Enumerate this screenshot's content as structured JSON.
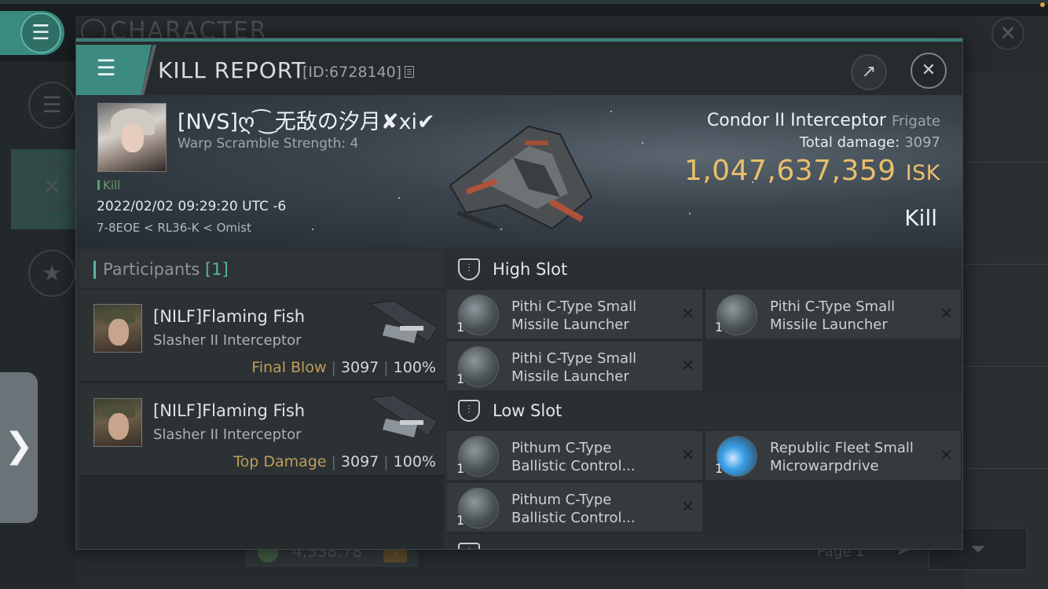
{
  "background": {
    "title": "CHARACTER",
    "footer_value": "4,338.78",
    "page_label": "Page 1"
  },
  "dialog": {
    "title": "KILL REPORT",
    "id_label": "[ID:6728140]"
  },
  "victim": {
    "name": "[NVS]ღ ͡ ͜ 无敌の汐月✘xi✔",
    "subtitle": "Warp Scramble Strength: 4",
    "badge": "Kill",
    "timestamp": "2022/02/02 09:29:20 UTC -6",
    "location": "7-8EOE < RL36-K < Omist",
    "ship_name": "Condor II Interceptor",
    "ship_class": "Frigate",
    "total_damage_label": "Total damage:",
    "total_damage": "3097",
    "isk_value": "1,047,637,359",
    "isk_unit": "ISK",
    "result": "Kill"
  },
  "participants": {
    "label": "Participants",
    "count": "[1]",
    "rows": [
      {
        "name": "[NILF]Flaming Fish",
        "ship": "Slasher II Interceptor",
        "role": "Final Blow",
        "damage": "3097",
        "percent": "100%"
      },
      {
        "name": "[NILF]Flaming Fish",
        "ship": "Slasher II Interceptor",
        "role": "Top Damage",
        "damage": "3097",
        "percent": "100%"
      }
    ]
  },
  "fittings": {
    "high_slot": {
      "label": "High Slot",
      "modules": [
        {
          "qty": "1",
          "line1": "Pithi C-Type Small",
          "line2": "Missile Launcher"
        },
        {
          "qty": "1",
          "line1": "Pithi C-Type Small",
          "line2": "Missile Launcher"
        },
        {
          "qty": "1",
          "line1": "Pithi C-Type Small",
          "line2": "Missile Launcher"
        }
      ]
    },
    "low_slot": {
      "label": "Low Slot",
      "modules": [
        {
          "qty": "1",
          "line1": "Pithum C-Type",
          "line2": "Ballistic Control..."
        },
        {
          "qty": "1",
          "line1": "Republic Fleet Small",
          "line2": "Microwarpdrive"
        },
        {
          "qty": "1",
          "line1": "Pithum C-Type",
          "line2": "Ballistic Control..."
        }
      ]
    }
  },
  "colors": {
    "accent": "#56b3a8",
    "isk": "#e9c06a",
    "role": "#bf9e5a"
  },
  "icons": {
    "menu": "hamburger-icon",
    "share": "external-link-icon",
    "close": "close-icon",
    "copy": "copy-icon",
    "slot": "shield-slot-icon",
    "remove": "x-icon"
  }
}
